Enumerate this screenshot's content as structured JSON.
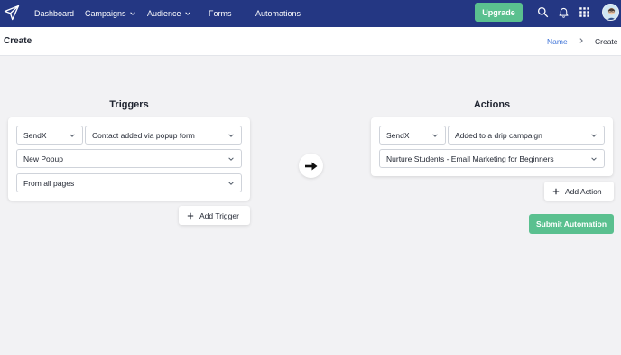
{
  "nav": {
    "items": [
      {
        "label": "Dashboard"
      },
      {
        "label": "Campaigns"
      },
      {
        "label": "Audience"
      },
      {
        "label": "Forms"
      },
      {
        "label": "Automations"
      }
    ],
    "upgrade_label": "Upgrade",
    "icons": [
      "paper-plane-logo-icon",
      "search-icon",
      "bell-icon",
      "apps-grid-icon",
      "avatar"
    ]
  },
  "header": {
    "title": "Create",
    "breadcrumb": {
      "link": "Name",
      "current": "Create"
    }
  },
  "triggers": {
    "title": "Triggers",
    "source": "SendX",
    "event": "Contact added via popup form",
    "popup": "New Popup",
    "pages": "From all pages",
    "add_label": "Add Trigger"
  },
  "actions": {
    "title": "Actions",
    "source": "SendX",
    "action": "Added to a drip campaign",
    "campaign": "Nurture Students - Email Marketing for Beginners",
    "add_label": "Add Action",
    "submit_label": "Submit Automation"
  },
  "colors": {
    "nav_bg": "#243783",
    "accent_green": "#5ac08f",
    "link_blue": "#3e73d8"
  }
}
